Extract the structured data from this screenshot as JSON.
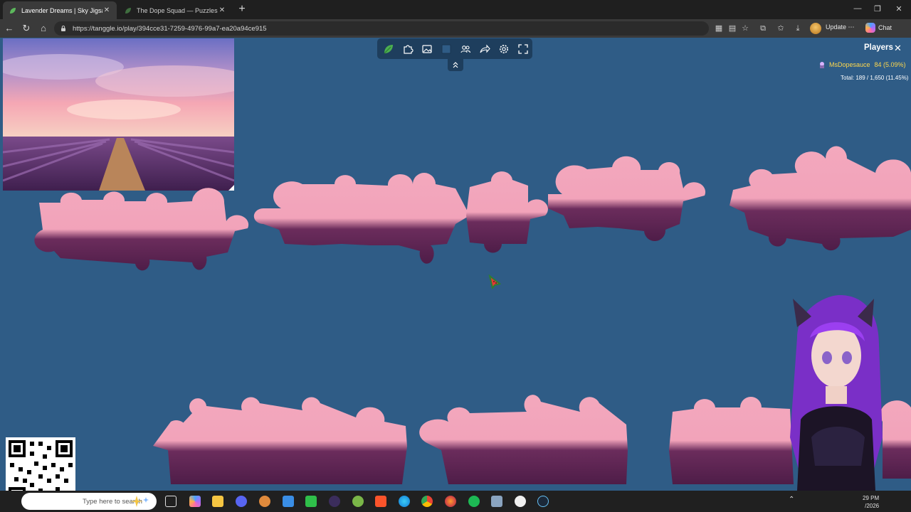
{
  "browser": {
    "tabs": [
      {
        "title": "Lavender Dreams | Sky Jigsaw",
        "active": true
      },
      {
        "title": "The Dope Squad — Puzzles",
        "active": false
      }
    ],
    "url": "https://tanggle.io/play/394cce31-7259-4976-99a7-ea20a94ce915",
    "update_label": "Update",
    "chat_label": "Chat"
  },
  "game": {
    "background_color": "#2f5c86",
    "toolbar_icons": [
      "tanggle-leaf-icon",
      "puzzle-piece-icon",
      "image-preview-icon",
      "background-color-icon",
      "players-icon",
      "share-icon",
      "settings-icon",
      "fullscreen-icon"
    ],
    "players_panel": {
      "title": "Players",
      "player": {
        "name": "MsDopesauce",
        "score": "84 (5.09%)"
      },
      "total": "Total: 189 / 1,650 (11.45%)"
    }
  },
  "taskbar": {
    "search_placeholder": "Type here to search",
    "clock_time": "29 PM",
    "clock_date": "/2026",
    "apps": [
      "task-view-icon",
      "copilot-icon",
      "file-explorer-icon",
      "discord-icon",
      "obs-icon",
      "kde-icon",
      "h-app-icon",
      "vtube-icon",
      "xbox-icon",
      "brave-icon",
      "edge-icon",
      "chrome-icon",
      "firefox-icon",
      "spotify-icon",
      "photos-icon",
      "steam-icon",
      "steam-client-icon"
    ]
  }
}
